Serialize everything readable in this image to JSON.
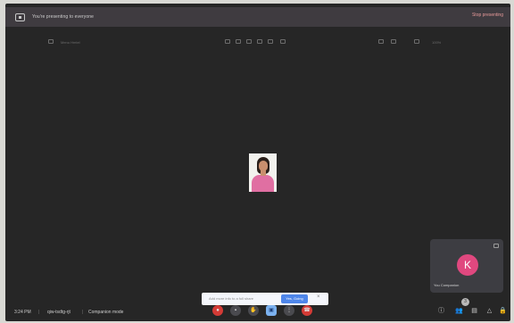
{
  "banner": {
    "text": "You're presenting to everyone",
    "stop_label": "Stop presenting",
    "icon": "present-screen-icon"
  },
  "doc_toolbar": {
    "title": "Menu Hmtel",
    "zoom": "100%"
  },
  "self_tile": {
    "avatar_letter": "K",
    "name": "You Companion"
  },
  "bottom_bar": {
    "time": "3:24 PM",
    "separator": "|",
    "meeting_code": "qiw-tsdtg-rjt",
    "mode": "Companion mode"
  },
  "toast": {
    "text": "Add more info to a full share",
    "button_label": "Yes, Going",
    "close": "×"
  },
  "controls": [
    {
      "name": "mic-button",
      "icon": "mic-off-icon",
      "glyph": "●",
      "style": "red"
    },
    {
      "name": "camera-button",
      "icon": "camera-icon",
      "glyph": "▪",
      "style": "normal"
    },
    {
      "name": "raise-hand-button",
      "icon": "hand-icon",
      "glyph": "✋",
      "style": "normal"
    },
    {
      "name": "present-button",
      "icon": "present-icon",
      "glyph": "▣",
      "style": "blue"
    },
    {
      "name": "more-options-button",
      "icon": "more-icon",
      "glyph": "⋮",
      "style": "normal"
    },
    {
      "name": "leave-call-button",
      "icon": "leave-call-icon",
      "glyph": "☎",
      "style": "red"
    }
  ],
  "side_icons": [
    {
      "name": "info-button",
      "icon": "info-icon",
      "glyph": "ⓘ"
    },
    {
      "name": "people-button",
      "icon": "people-icon",
      "glyph": "👥"
    },
    {
      "name": "chat-button",
      "icon": "chat-icon",
      "glyph": "▤"
    },
    {
      "name": "activities-button",
      "icon": "activities-icon",
      "glyph": "△"
    },
    {
      "name": "host-controls-button",
      "icon": "lock-icon",
      "glyph": "🔒"
    }
  ],
  "people_badge": "3",
  "colors": {
    "frame": "#262626",
    "banner": "#3f3b40",
    "stop_presenting": "#e79a9a",
    "avatar": "#e0487f",
    "leave_call": "#d43b36",
    "present_active": "#7cb2f0",
    "toast_button": "#4e86ea"
  }
}
